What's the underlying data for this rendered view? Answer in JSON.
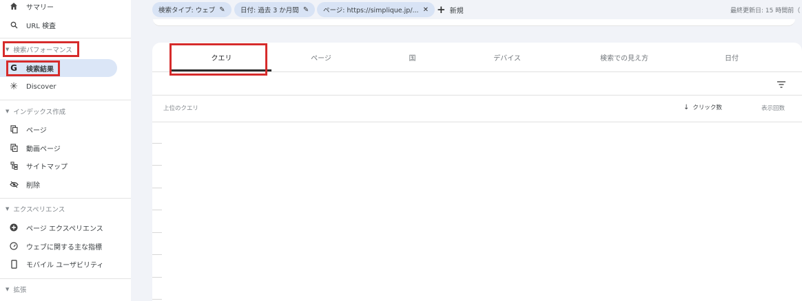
{
  "sidebar": {
    "summary": "サマリー",
    "url_inspection": "URL 検査",
    "sections": [
      {
        "title": "検索パフォーマンス",
        "items": [
          {
            "label": "検索結果"
          },
          {
            "label": "Discover"
          }
        ]
      },
      {
        "title": "インデックス作成",
        "items": [
          {
            "label": "ページ"
          },
          {
            "label": "動画ページ"
          },
          {
            "label": "サイトマップ"
          },
          {
            "label": "削除"
          }
        ]
      },
      {
        "title": "エクスペリエンス",
        "items": [
          {
            "label": "ページ エクスペリエンス"
          },
          {
            "label": "ウェブに関する主な指標"
          },
          {
            "label": "モバイル ユーザビリティ"
          }
        ]
      },
      {
        "title": "拡張",
        "items": []
      }
    ]
  },
  "filters": {
    "chips": [
      {
        "label": "検索タイプ: ウェブ"
      },
      {
        "label": "日付: 過去 3 か月間"
      },
      {
        "label": "ページ: https://simplique.jp/..."
      }
    ],
    "new_label": "新規",
    "last_update": "最終更新日: 15 時間前（"
  },
  "tabs": [
    {
      "label": "クエリ",
      "active": true
    },
    {
      "label": "ページ"
    },
    {
      "label": "国"
    },
    {
      "label": "デバイス"
    },
    {
      "label": "検索での見え方"
    },
    {
      "label": "日付"
    }
  ],
  "table": {
    "col_query": "上位のクエリ",
    "col_clicks": "クリック数",
    "col_impressions": "表示回数"
  },
  "colors": {
    "highlight": "#d62b2b",
    "active_nav_bg": "#dbe6f7",
    "chip_bg": "#d8e3f5"
  }
}
